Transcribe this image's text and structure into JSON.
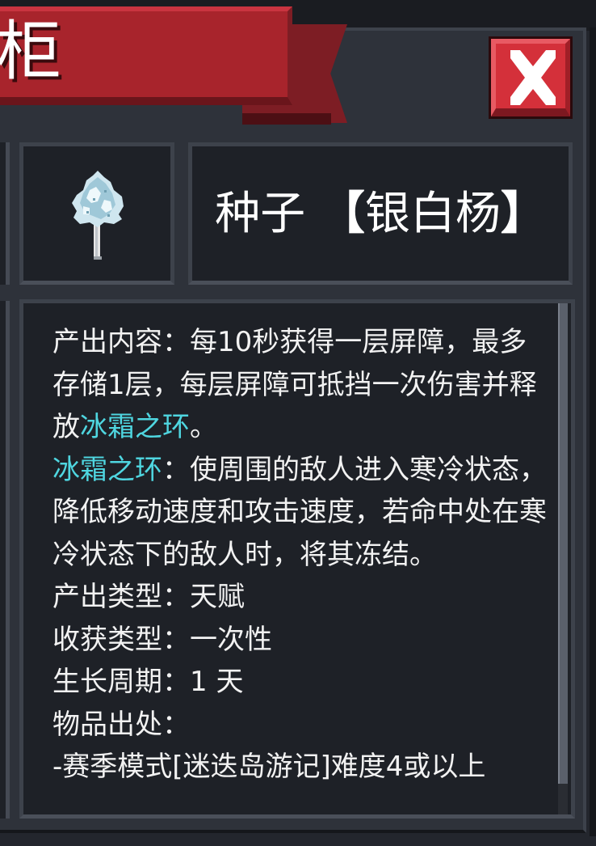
{
  "window": {
    "title_fragment": "柜",
    "close_label": "close"
  },
  "item": {
    "icon": "silver-poplar-tree-icon",
    "name_prefix": "种子",
    "bracket_open": "【",
    "name_core": "银白杨",
    "bracket_close": "】"
  },
  "description": {
    "line1_pre": "产出内容：每10秒获得一层屏障，最多存储1层，每层屏障可抵挡一次伤害并释放",
    "line1_highlight": "冰霜之环",
    "line1_post": "。",
    "line2_highlight": "冰霜之环",
    "line2_post": "：使周围的敌人进入寒冷状态，降低移动速度和攻击速度，若命中处在寒冷状态下的敌人时，将其冻结。",
    "produce_type": "产出类型：天赋",
    "harvest_type": "收获类型：一次性",
    "growth_cycle": "生长周期：1 天",
    "source_label": "物品出处：",
    "source_value": "-赛季模式[迷迭岛游记]难度4或以上"
  },
  "colors": {
    "ribbon": "#a8242c",
    "close_button": "#d4303a",
    "highlight": "#4fd6e0",
    "panel_bg": "#1e2127"
  },
  "scroll": {
    "thumb_fraction": 0.94
  }
}
